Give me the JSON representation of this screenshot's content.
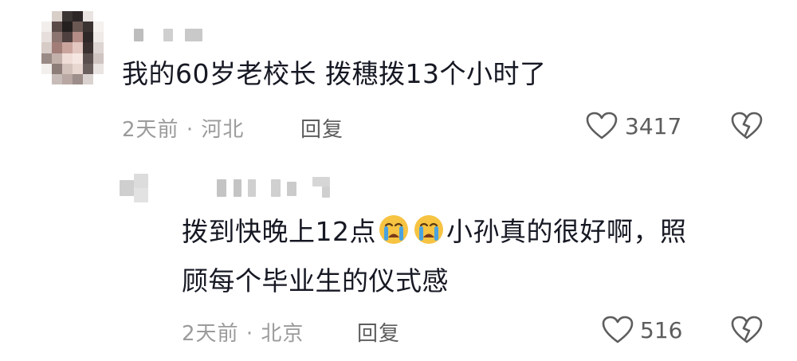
{
  "comment": {
    "text": "我的60岁老校长 拨穗拨13个小时了",
    "time": "2天前",
    "separator": "·",
    "location": "河北",
    "reply_label": "回复",
    "like_count": "3417"
  },
  "reply": {
    "text_before_emoji": "拨到快晚上12点",
    "text_after_emoji": "小孙真的很好啊，照",
    "text_line2": "顾每个毕业生的仪式感",
    "emoji_name": "crying-face",
    "time": "2天前",
    "separator": "·",
    "location": "北京",
    "reply_label": "回复",
    "like_count": "516"
  },
  "colors": {
    "text_primary": "#161823",
    "text_meta": "#9b9b9b",
    "text_action": "#5d5d5d",
    "emoji_face": "#f6c342",
    "emoji_tear": "#4aa3df"
  },
  "icons": {
    "like": "heart-outline-icon",
    "dislike": "broken-heart-icon"
  }
}
